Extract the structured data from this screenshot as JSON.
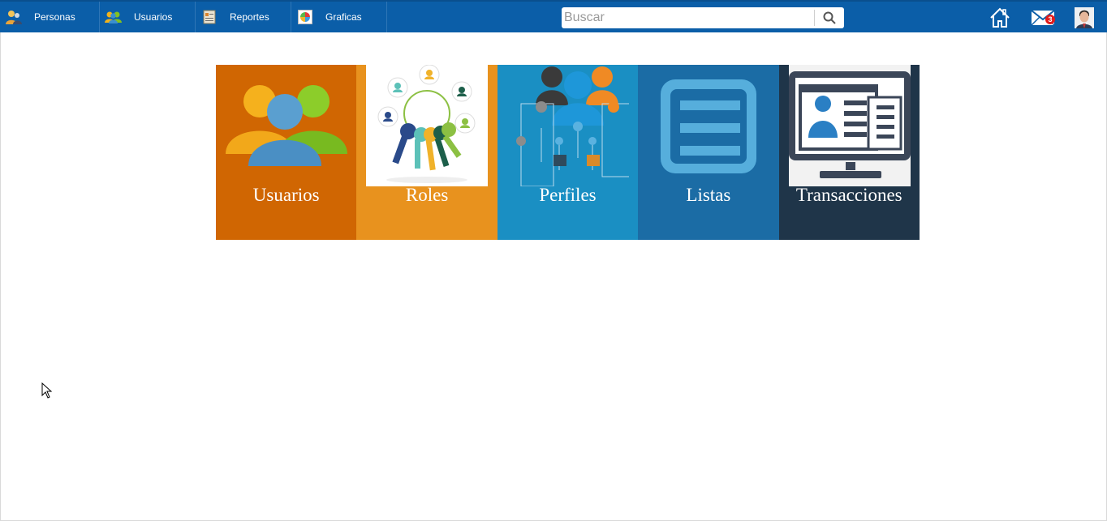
{
  "navbar": {
    "items": [
      {
        "label": "Personas",
        "icon": "people-icon"
      },
      {
        "label": "Usuarios",
        "icon": "users-icon"
      },
      {
        "label": "Reportes",
        "icon": "report-icon"
      },
      {
        "label": "Graficas",
        "icon": "chart-icon"
      }
    ],
    "search": {
      "placeholder": "Buscar",
      "value": ""
    },
    "mail_count": "3"
  },
  "tiles": [
    {
      "label": "Usuarios",
      "color": "#d06602"
    },
    {
      "label": "Roles",
      "color": "#e8921e"
    },
    {
      "label": "Perfiles",
      "color": "#1a8fc3"
    },
    {
      "label": "Listas",
      "color": "#1b6ca5"
    },
    {
      "label": "Transacciones",
      "color": "#1f3549"
    }
  ],
  "colors": {
    "navbar": "#0b5ea8",
    "accent": "#e21b1b"
  }
}
